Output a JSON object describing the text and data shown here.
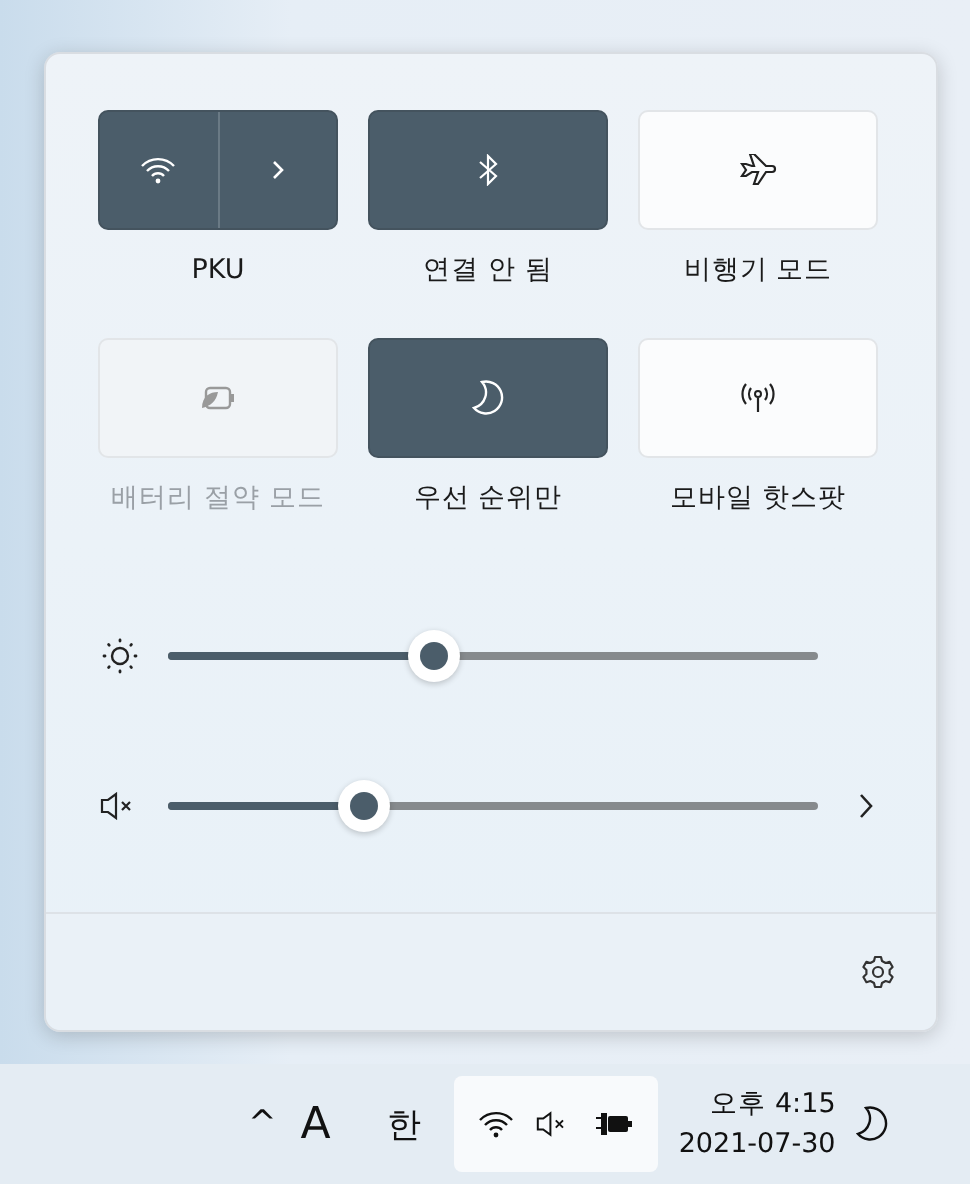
{
  "tiles": [
    {
      "kind": "split",
      "label": "PKU",
      "on": true,
      "disabled": false
    },
    {
      "kind": "single",
      "label": "연결 안 됨",
      "on": true,
      "disabled": false
    },
    {
      "kind": "single",
      "label": "비행기 모드",
      "on": false,
      "disabled": false
    },
    {
      "kind": "single",
      "label": "배터리 절약 모드",
      "on": false,
      "disabled": true
    },
    {
      "kind": "single",
      "label": "우선 순위만",
      "on": true,
      "disabled": false
    },
    {
      "kind": "single",
      "label": "모바일 핫스팟",
      "on": false,
      "disabled": false
    }
  ],
  "sliders": [
    {
      "kind": "brightness",
      "level": 0.41,
      "more": false
    },
    {
      "kind": "volume",
      "level": 0.3,
      "muted": true,
      "more": true
    }
  ],
  "taskbar": {
    "chevron": "^",
    "input_mode": "A",
    "ime": "한",
    "tray_selected": true,
    "time": "오후 4:15",
    "date": "2021-07-30"
  }
}
